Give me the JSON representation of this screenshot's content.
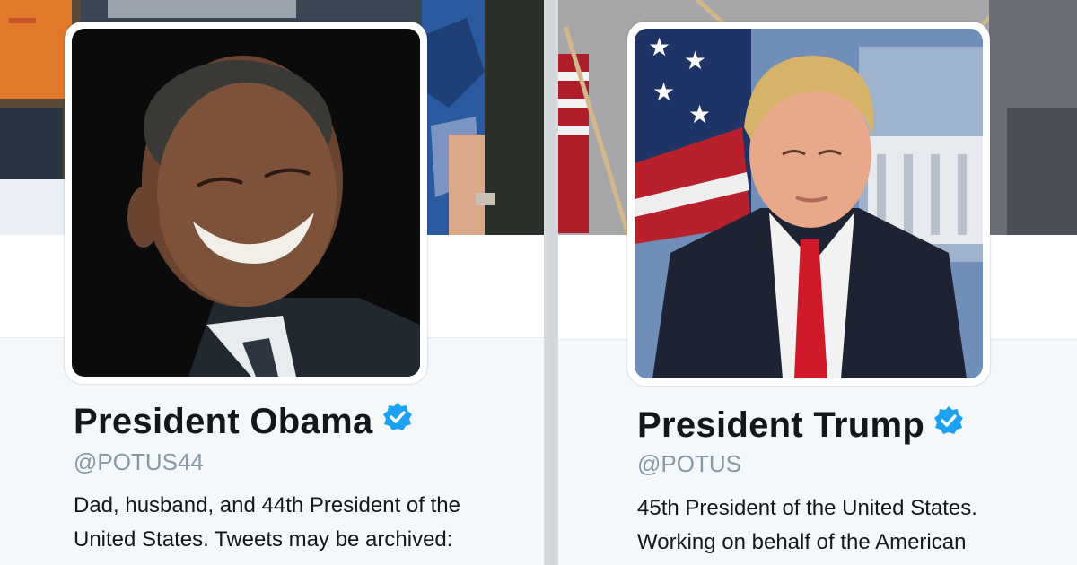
{
  "profiles": [
    {
      "display_name": "President Obama",
      "verified": true,
      "handle": "@POTUS44",
      "bio_lines": [
        "Dad, husband, and 44th President of the",
        "United States. Tweets may be archived:"
      ]
    },
    {
      "display_name": "President Trump",
      "verified": true,
      "handle": "@POTUS",
      "bio_lines": [
        "45th President of the United States.",
        "Working on behalf of the American"
      ]
    }
  ],
  "colors": {
    "name_text": "#14171a",
    "handle_text": "#8899a6",
    "verified_blue": "#1da1f2",
    "profile_bg": "#f5f8fa"
  },
  "icons": {
    "verified": "verified-badge-icon"
  }
}
